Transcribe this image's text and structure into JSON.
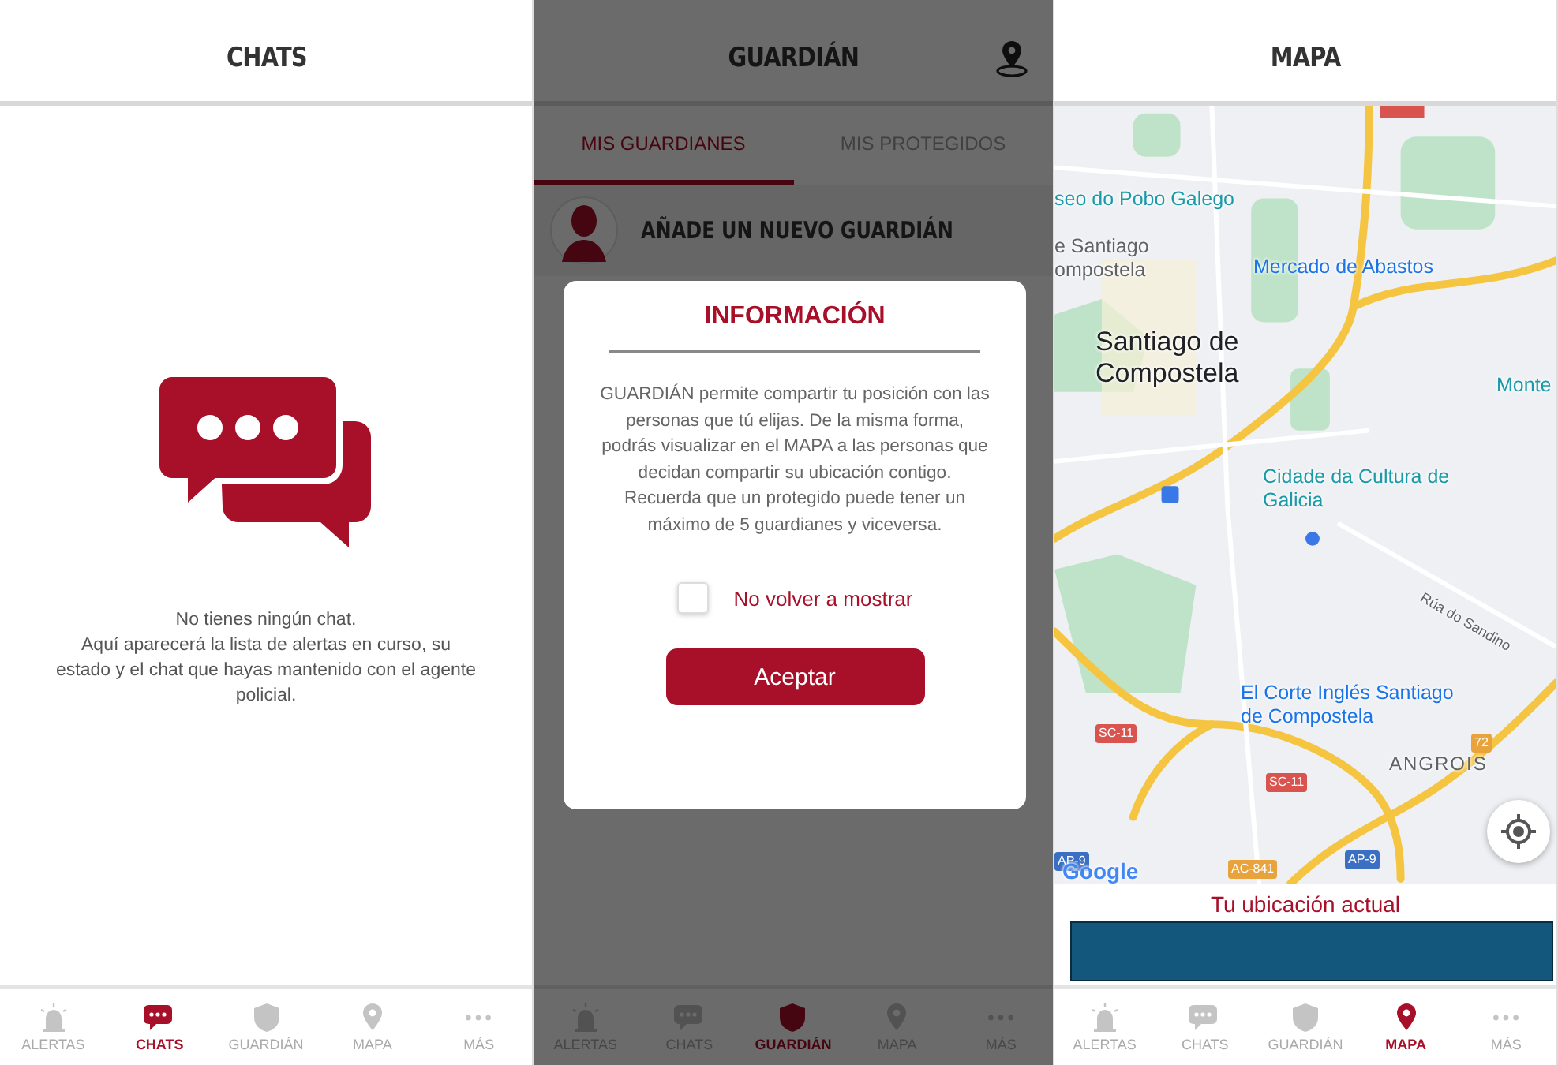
{
  "screens": [
    {
      "kind": "chats",
      "title": "CHATS",
      "empty_message": [
        "No tienes ningún chat.",
        "Aquí aparecerá la lista de alertas en curso, su estado y el chat que hayas mantenido con el agente policial."
      ],
      "nav": [
        {
          "kind": "alert",
          "label": "ALERTAS",
          "selected": false
        },
        {
          "kind": "chat",
          "label": "CHATS",
          "selected": true
        },
        {
          "kind": "shield",
          "label": "GUARDIÁN",
          "selected": false
        },
        {
          "kind": "pin",
          "label": "MAPA",
          "selected": false
        },
        {
          "kind": "more",
          "label": "MÁS",
          "selected": false
        }
      ]
    },
    {
      "kind": "guardian",
      "title": "GUARDIÁN",
      "tabs": [
        {
          "label": "MIS GUARDIANES",
          "selected": true
        },
        {
          "label": "MIS PROTEGIDOS",
          "selected": false
        }
      ],
      "add_label": "AÑADE UN NUEVO GUARDIÁN",
      "dialog": {
        "title": "INFORMACIÓN",
        "body": "GUARDIÁN permite compartir tu posición con las personas que tú elijas. De la misma forma, podrás visualizar en el MAPA a las personas que decidan compartir su ubicación contigo. Recuerda que un protegido puede tener un máximo de 5 guardianes y viceversa.",
        "checkbox": {
          "label": "No volver a mostrar",
          "checked": false
        },
        "button": "Aceptar"
      },
      "nav": [
        {
          "kind": "alert",
          "label": "ALERTAS",
          "selected": false
        },
        {
          "kind": "chat",
          "label": "CHATS",
          "selected": false
        },
        {
          "kind": "shield",
          "label": "GUARDIÁN",
          "selected": true
        },
        {
          "kind": "pin",
          "label": "MAPA",
          "selected": false
        },
        {
          "kind": "more",
          "label": "MÁS",
          "selected": false
        }
      ]
    },
    {
      "kind": "map",
      "title": "MAPA",
      "map_labels": [
        {
          "kind": "poi",
          "text": "seo do Pobo Galego",
          "color": "#1a9aa8"
        },
        {
          "kind": "poi",
          "text": "e Santiago",
          "color": "#5f6368"
        },
        {
          "kind": "poi",
          "text": "ompostela",
          "color": "#5f6368"
        },
        {
          "kind": "poi",
          "text": "Mercado de Abastos",
          "color": "#1a73e8"
        },
        {
          "kind": "city",
          "text": "Santiago de Compostela",
          "color": "#202124"
        },
        {
          "kind": "poi",
          "text": "Monte",
          "color": "#1a9aa8"
        },
        {
          "kind": "poi",
          "text": "Cidade da Cultura de Galicia",
          "color": "#1a9aa8"
        },
        {
          "kind": "street",
          "text": "Rúa do Sandino",
          "color": "#5f6368"
        },
        {
          "kind": "poi",
          "text": "El Corte Inglés Santiago de Compostela",
          "color": "#1a73e8"
        },
        {
          "kind": "area",
          "text": "ANGROIS",
          "color": "#5f6368"
        },
        {
          "kind": "shield",
          "text": "SC-11",
          "color": "#d9534f"
        },
        {
          "kind": "shield",
          "text": "SC-11",
          "color": "#d9534f"
        },
        {
          "kind": "shield",
          "text": "AP-9",
          "color": "#3b6fc4"
        },
        {
          "kind": "shield",
          "text": "AP-9",
          "color": "#3b6fc4"
        },
        {
          "kind": "shield",
          "text": "AC-841",
          "color": "#e8a33d"
        },
        {
          "kind": "shield",
          "text": "72",
          "color": "#e8a33d"
        },
        {
          "kind": "logo",
          "text": "Google",
          "color": "#4285f4"
        }
      ],
      "location_label": "Tu ubicación actual",
      "nav": [
        {
          "kind": "alert",
          "label": "ALERTAS",
          "selected": false
        },
        {
          "kind": "chat",
          "label": "CHATS",
          "selected": false
        },
        {
          "kind": "shield",
          "label": "GUARDIÁN",
          "selected": false
        },
        {
          "kind": "pin",
          "label": "MAPA",
          "selected": true
        },
        {
          "kind": "more",
          "label": "MÁS",
          "selected": false
        }
      ]
    }
  ]
}
